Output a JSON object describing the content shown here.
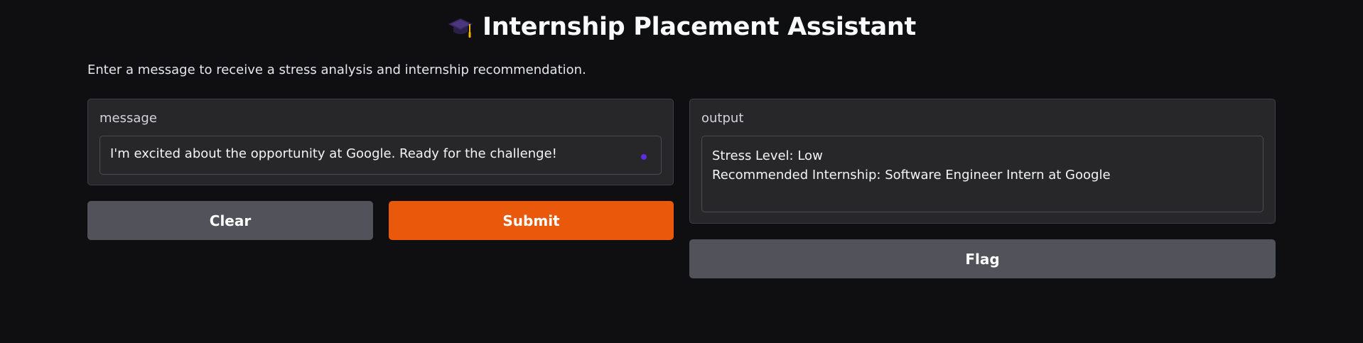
{
  "header": {
    "icon": "graduation-cap-icon",
    "title": "Internship Placement Assistant"
  },
  "description": "Enter a message to receive a stress analysis and internship recommendation.",
  "input_panel": {
    "label": "message",
    "value": "I'm excited about the opportunity at Google. Ready for the challenge!"
  },
  "output_panel": {
    "label": "output",
    "lines": [
      "Stress Level: Low",
      "Recommended Internship: Software Engineer Intern at Google"
    ]
  },
  "buttons": {
    "clear_label": "Clear",
    "submit_label": "Submit",
    "flag_label": "Flag"
  },
  "colors": {
    "background": "#0f0f11",
    "panel": "#27272a",
    "primary": "#ea580c",
    "secondary": "#52525b",
    "indicator": "#5b2ee6"
  }
}
